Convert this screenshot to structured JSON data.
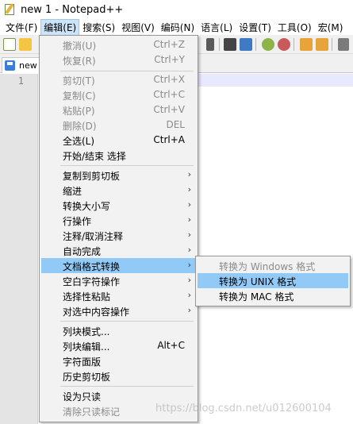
{
  "window": {
    "title": "new 1 - Notepad++"
  },
  "menubar": [
    "文件(F)",
    "编辑(E)",
    "搜索(S)",
    "视图(V)",
    "编码(N)",
    "语言(L)",
    "设置(T)",
    "工具(O)",
    "宏(M)"
  ],
  "tab": {
    "label": "new"
  },
  "editor": {
    "line_number": "1"
  },
  "edit_menu": {
    "undo": {
      "label": "撤消(U)",
      "shortcut": "Ctrl+Z"
    },
    "redo": {
      "label": "恢复(R)",
      "shortcut": "Ctrl+Y"
    },
    "cut": {
      "label": "剪切(T)",
      "shortcut": "Ctrl+X"
    },
    "copy": {
      "label": "复制(C)",
      "shortcut": "Ctrl+C"
    },
    "paste": {
      "label": "粘贴(P)",
      "shortcut": "Ctrl+V"
    },
    "delete": {
      "label": "删除(D)",
      "shortcut": "DEL"
    },
    "select_all": {
      "label": "全选(L)",
      "shortcut": "Ctrl+A"
    },
    "begin_end_select": {
      "label": "开始/结束 选择"
    },
    "copy_to_clipboard": {
      "label": "复制到剪切板"
    },
    "indent": {
      "label": "缩进"
    },
    "convert_case": {
      "label": "转换大小写"
    },
    "line_operations": {
      "label": "行操作"
    },
    "comment": {
      "label": "注释/取消注释"
    },
    "auto_complete": {
      "label": "自动完成"
    },
    "eol_conversion": {
      "label": "文档格式转换"
    },
    "blank_operations": {
      "label": "空白字符操作"
    },
    "paste_special": {
      "label": "选择性粘贴"
    },
    "on_selection": {
      "label": "对选中内容操作"
    },
    "column_mode": {
      "label": "列块模式..."
    },
    "column_editor": {
      "label": "列块编辑...",
      "shortcut": "Alt+C"
    },
    "char_panel": {
      "label": "字符面版"
    },
    "clipboard_history": {
      "label": "历史剪切板"
    },
    "set_read_only": {
      "label": "设为只读"
    },
    "clear_read_only": {
      "label": "清除只读标记"
    }
  },
  "eol_submenu": {
    "to_windows": "转换为 Windows 格式",
    "to_unix": "转换为 UNIX 格式",
    "to_mac": "转换为 MAC 格式"
  },
  "watermark": "https://blog.csdn.net/u012600104"
}
